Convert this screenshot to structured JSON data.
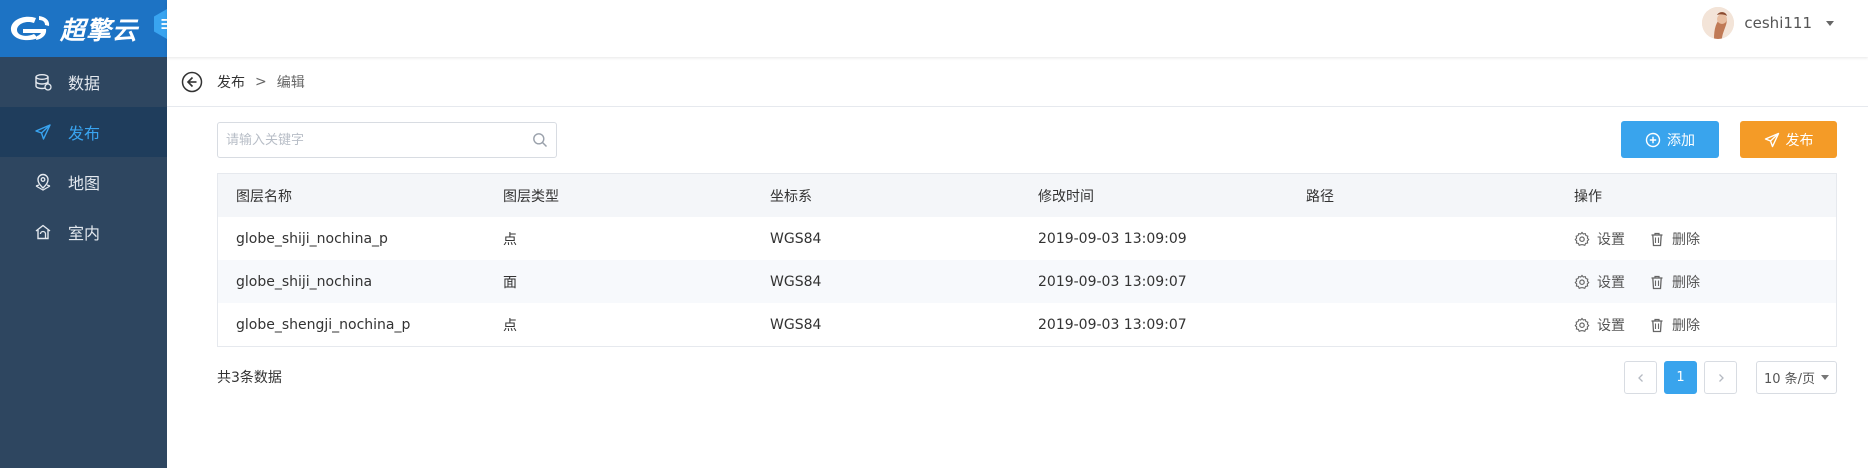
{
  "brand": {
    "name": "超擎云",
    "logo_color": "#ffffff",
    "bar_color": "#1d73c4"
  },
  "sidebar": {
    "background": "#2e4660",
    "active_color": "#39a4f0",
    "items": [
      {
        "label": "数据",
        "icon": "database-icon",
        "active": false
      },
      {
        "label": "发布",
        "icon": "send-icon",
        "active": true
      },
      {
        "label": "地图",
        "icon": "map-pin-icon",
        "active": false
      },
      {
        "label": "室内",
        "icon": "home-icon",
        "active": false
      }
    ]
  },
  "header": {
    "username": "ceshi111"
  },
  "breadcrumb": {
    "items": [
      "发布",
      "编辑"
    ],
    "separator": ">"
  },
  "toolbar": {
    "search_placeholder": "请输入关键字",
    "add_label": "添加",
    "publish_label": "发布",
    "add_color": "#39a4ed",
    "publish_color": "#f49b27"
  },
  "table": {
    "columns": [
      "图层名称",
      "图层类型",
      "坐标系",
      "修改时间",
      "路径",
      "操作"
    ],
    "rows": [
      {
        "name": "globe_shiji_nochina_p",
        "type": "点",
        "crs": "WGS84",
        "modified": "2019-09-03 13:09:09",
        "path": ""
      },
      {
        "name": "globe_shiji_nochina",
        "type": "面",
        "crs": "WGS84",
        "modified": "2019-09-03 13:09:07",
        "path": ""
      },
      {
        "name": "globe_shengji_nochina_p",
        "type": "点",
        "crs": "WGS84",
        "modified": "2019-09-03 13:09:07",
        "path": ""
      }
    ],
    "actions": {
      "settings": "设置",
      "delete": "删除"
    }
  },
  "footer": {
    "total": "共3条数据",
    "current_page": "1",
    "page_size": "10 条/页",
    "prev_icon": "chevron-left-icon",
    "next_icon": "chevron-right-icon"
  }
}
